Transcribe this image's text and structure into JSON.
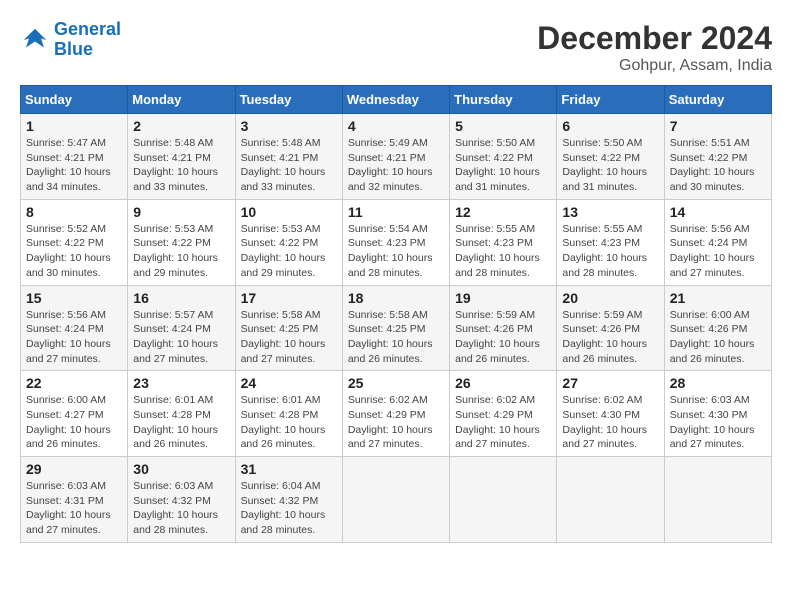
{
  "header": {
    "logo_line1": "General",
    "logo_line2": "Blue",
    "title": "December 2024",
    "subtitle": "Gohpur, Assam, India"
  },
  "calendar": {
    "days_of_week": [
      "Sunday",
      "Monday",
      "Tuesday",
      "Wednesday",
      "Thursday",
      "Friday",
      "Saturday"
    ],
    "weeks": [
      [
        null,
        {
          "day": 2,
          "sunrise": "5:48 AM",
          "sunset": "4:21 PM",
          "daylight": "10 hours and 33 minutes."
        },
        {
          "day": 3,
          "sunrise": "5:48 AM",
          "sunset": "4:21 PM",
          "daylight": "10 hours and 33 minutes."
        },
        {
          "day": 4,
          "sunrise": "5:49 AM",
          "sunset": "4:21 PM",
          "daylight": "10 hours and 32 minutes."
        },
        {
          "day": 5,
          "sunrise": "5:50 AM",
          "sunset": "4:22 PM",
          "daylight": "10 hours and 31 minutes."
        },
        {
          "day": 6,
          "sunrise": "5:50 AM",
          "sunset": "4:22 PM",
          "daylight": "10 hours and 31 minutes."
        },
        {
          "day": 7,
          "sunrise": "5:51 AM",
          "sunset": "4:22 PM",
          "daylight": "10 hours and 30 minutes."
        }
      ],
      [
        {
          "day": 1,
          "sunrise": "5:47 AM",
          "sunset": "4:21 PM",
          "daylight": "10 hours and 34 minutes."
        },
        {
          "day": 8,
          "sunrise": "5:52 AM",
          "sunset": "4:22 PM",
          "daylight": "10 hours and 30 minutes."
        },
        {
          "day": 9,
          "sunrise": "5:53 AM",
          "sunset": "4:22 PM",
          "daylight": "10 hours and 29 minutes."
        },
        {
          "day": 10,
          "sunrise": "5:53 AM",
          "sunset": "4:22 PM",
          "daylight": "10 hours and 29 minutes."
        },
        {
          "day": 11,
          "sunrise": "5:54 AM",
          "sunset": "4:23 PM",
          "daylight": "10 hours and 28 minutes."
        },
        {
          "day": 12,
          "sunrise": "5:55 AM",
          "sunset": "4:23 PM",
          "daylight": "10 hours and 28 minutes."
        },
        {
          "day": 13,
          "sunrise": "5:55 AM",
          "sunset": "4:23 PM",
          "daylight": "10 hours and 28 minutes."
        },
        {
          "day": 14,
          "sunrise": "5:56 AM",
          "sunset": "4:24 PM",
          "daylight": "10 hours and 27 minutes."
        }
      ],
      [
        {
          "day": 15,
          "sunrise": "5:56 AM",
          "sunset": "4:24 PM",
          "daylight": "10 hours and 27 minutes."
        },
        {
          "day": 16,
          "sunrise": "5:57 AM",
          "sunset": "4:24 PM",
          "daylight": "10 hours and 27 minutes."
        },
        {
          "day": 17,
          "sunrise": "5:58 AM",
          "sunset": "4:25 PM",
          "daylight": "10 hours and 27 minutes."
        },
        {
          "day": 18,
          "sunrise": "5:58 AM",
          "sunset": "4:25 PM",
          "daylight": "10 hours and 26 minutes."
        },
        {
          "day": 19,
          "sunrise": "5:59 AM",
          "sunset": "4:26 PM",
          "daylight": "10 hours and 26 minutes."
        },
        {
          "day": 20,
          "sunrise": "5:59 AM",
          "sunset": "4:26 PM",
          "daylight": "10 hours and 26 minutes."
        },
        {
          "day": 21,
          "sunrise": "6:00 AM",
          "sunset": "4:26 PM",
          "daylight": "10 hours and 26 minutes."
        }
      ],
      [
        {
          "day": 22,
          "sunrise": "6:00 AM",
          "sunset": "4:27 PM",
          "daylight": "10 hours and 26 minutes."
        },
        {
          "day": 23,
          "sunrise": "6:01 AM",
          "sunset": "4:28 PM",
          "daylight": "10 hours and 26 minutes."
        },
        {
          "day": 24,
          "sunrise": "6:01 AM",
          "sunset": "4:28 PM",
          "daylight": "10 hours and 26 minutes."
        },
        {
          "day": 25,
          "sunrise": "6:02 AM",
          "sunset": "4:29 PM",
          "daylight": "10 hours and 27 minutes."
        },
        {
          "day": 26,
          "sunrise": "6:02 AM",
          "sunset": "4:29 PM",
          "daylight": "10 hours and 27 minutes."
        },
        {
          "day": 27,
          "sunrise": "6:02 AM",
          "sunset": "4:30 PM",
          "daylight": "10 hours and 27 minutes."
        },
        {
          "day": 28,
          "sunrise": "6:03 AM",
          "sunset": "4:30 PM",
          "daylight": "10 hours and 27 minutes."
        }
      ],
      [
        {
          "day": 29,
          "sunrise": "6:03 AM",
          "sunset": "4:31 PM",
          "daylight": "10 hours and 27 minutes."
        },
        {
          "day": 30,
          "sunrise": "6:03 AM",
          "sunset": "4:32 PM",
          "daylight": "10 hours and 28 minutes."
        },
        {
          "day": 31,
          "sunrise": "6:04 AM",
          "sunset": "4:32 PM",
          "daylight": "10 hours and 28 minutes."
        },
        null,
        null,
        null,
        null
      ]
    ]
  }
}
